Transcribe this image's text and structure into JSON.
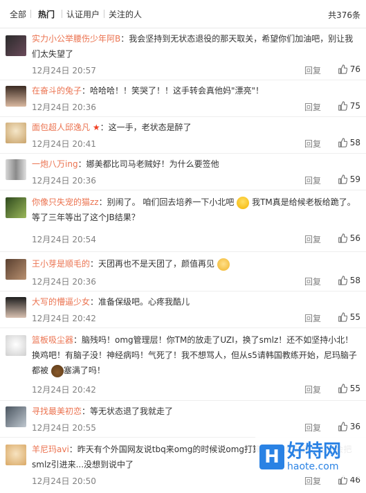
{
  "header": {
    "tabs": [
      {
        "label": "全部"
      },
      {
        "label": "热门"
      },
      {
        "label": "认证用户"
      },
      {
        "label": "关注的人"
      }
    ],
    "count": "共376条"
  },
  "comments": [
    {
      "nick": "实力小公举腰伤少年阿B",
      "text": "：我会坚持到无状态退役的那天取关，希望你们加油吧，别让我们太失望了",
      "time": "12月24日 20:57",
      "reply": "回复",
      "likes": "76"
    },
    {
      "nick": "在奋斗的兔子",
      "text": "：哈哈哈！！笑哭了！！这手转会真他妈\"漂亮\"！",
      "time": "12月24日 20:36",
      "reply": "回复",
      "likes": "75"
    },
    {
      "nick": "面包超人邱逸凡",
      "text": "：这一手，老状态是醉了",
      "time": "12月24日 20:41",
      "reply": "回复",
      "likes": "58"
    },
    {
      "nick": "一炮八万ing",
      "text": "：娜美都比司马老贼好！为什么要签他",
      "time": "12月24日 20:36",
      "reply": "回复",
      "likes": "59"
    },
    {
      "nick": "你像只失宠的猫zz",
      "text1": "：别闹了。 咱们回去培养一下小北吧",
      "text2": "我TM真是给候老板给跪了。等了三年等出了这个JB结果？",
      "time": "12月24日 20:54",
      "reply": "回复",
      "likes": "56"
    },
    {
      "nick": "王小芽是顺毛的",
      "text": "：天团再也不是天团了，颜值再见",
      "time": "12月24日 20:36",
      "reply": "回复",
      "likes": "58"
    },
    {
      "nick": "大写的懵逼少女",
      "text": "：准备保级吧。心疼我酷儿",
      "time": "12月24日 20:42",
      "reply": "回复",
      "likes": "55"
    },
    {
      "nick": "篮板吸尘器",
      "text1": "：脑残吗！omg管理层！你TM的放走了UZI，换了smlz！还不如坚持小北！换鸡吧！有脑子没！神经病吗！气死了！我不想骂人，但从s5请韩国教练开始，尼玛脑子都被",
      "text2": "塞满了吗！",
      "time": "12月24日 20:42",
      "reply": "回复",
      "likes": "55"
    },
    {
      "nick": "寻找最美初恋",
      "text": "：等无状态退了我就走了",
      "time": "12月24日 20:55",
      "reply": "回复",
      "likes": "36"
    },
    {
      "nick": "羊尼玛avi",
      "text": "：昨天有个外国网友说tbq来omg的时候说omg打算打造最烂战队...可能会把smlz引进来...没想到说中了",
      "time": "12月24日 20:50",
      "reply": "回复",
      "likes": "46"
    }
  ],
  "watermark": {
    "big": "好特网",
    "small": "haote.com",
    "logo": "H"
  },
  "colors": {
    "nick": "#eb7350",
    "meta": "#808080",
    "brand": "#2a82e4"
  },
  "icons": {
    "like": "thumbs-up-icon",
    "vip": "red-star-icon"
  }
}
